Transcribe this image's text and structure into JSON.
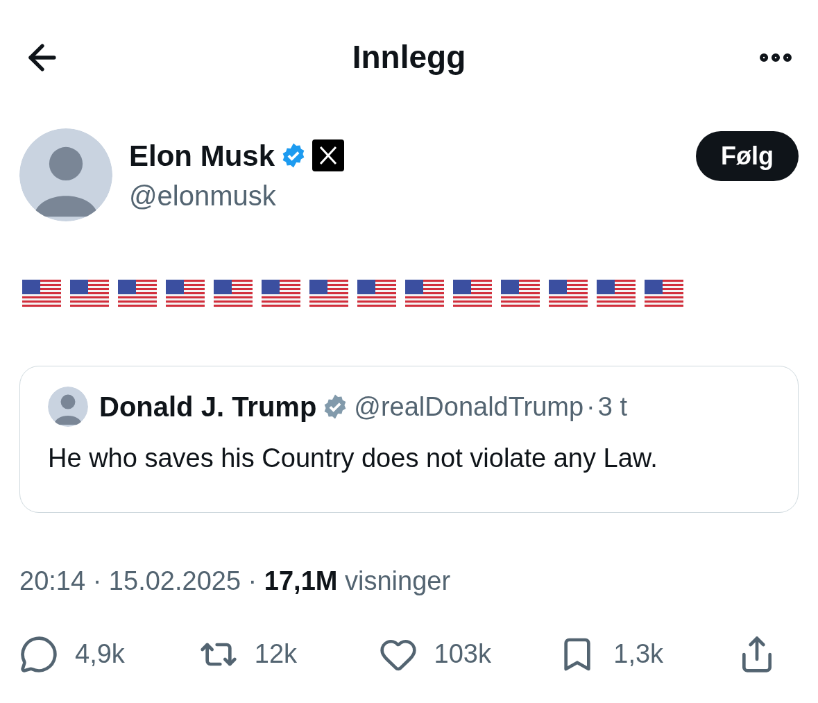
{
  "header": {
    "title": "Innlegg"
  },
  "author": {
    "name": "Elon Musk",
    "verified": true,
    "handle": "@elonmusk",
    "follow_label": "Følg"
  },
  "post": {
    "flags": [
      {
        "kind": "us-flag"
      },
      {
        "kind": "us-flag"
      },
      {
        "kind": "us-flag"
      },
      {
        "kind": "us-flag"
      },
      {
        "kind": "us-flag"
      },
      {
        "kind": "us-flag"
      },
      {
        "kind": "us-flag"
      },
      {
        "kind": "us-flag"
      },
      {
        "kind": "us-flag"
      },
      {
        "kind": "us-flag"
      },
      {
        "kind": "us-flag"
      },
      {
        "kind": "us-flag"
      },
      {
        "kind": "us-flag"
      },
      {
        "kind": "us-flag"
      }
    ]
  },
  "quote": {
    "name": "Donald J. Trump",
    "verified": true,
    "handle": "@realDonaldTrump",
    "separator": "·",
    "time": "3 t",
    "text": "He who saves his Country does not violate any Law."
  },
  "meta": "20:14 · 15.02.2025 · **17,1M** visninger",
  "actions": [
    {
      "kind": "reply",
      "count": "4,9k"
    },
    {
      "kind": "repost",
      "count": "12k"
    },
    {
      "kind": "like",
      "count": "103k"
    },
    {
      "kind": "bookmark",
      "count": "1,3k"
    },
    {
      "kind": "share"
    }
  ]
}
